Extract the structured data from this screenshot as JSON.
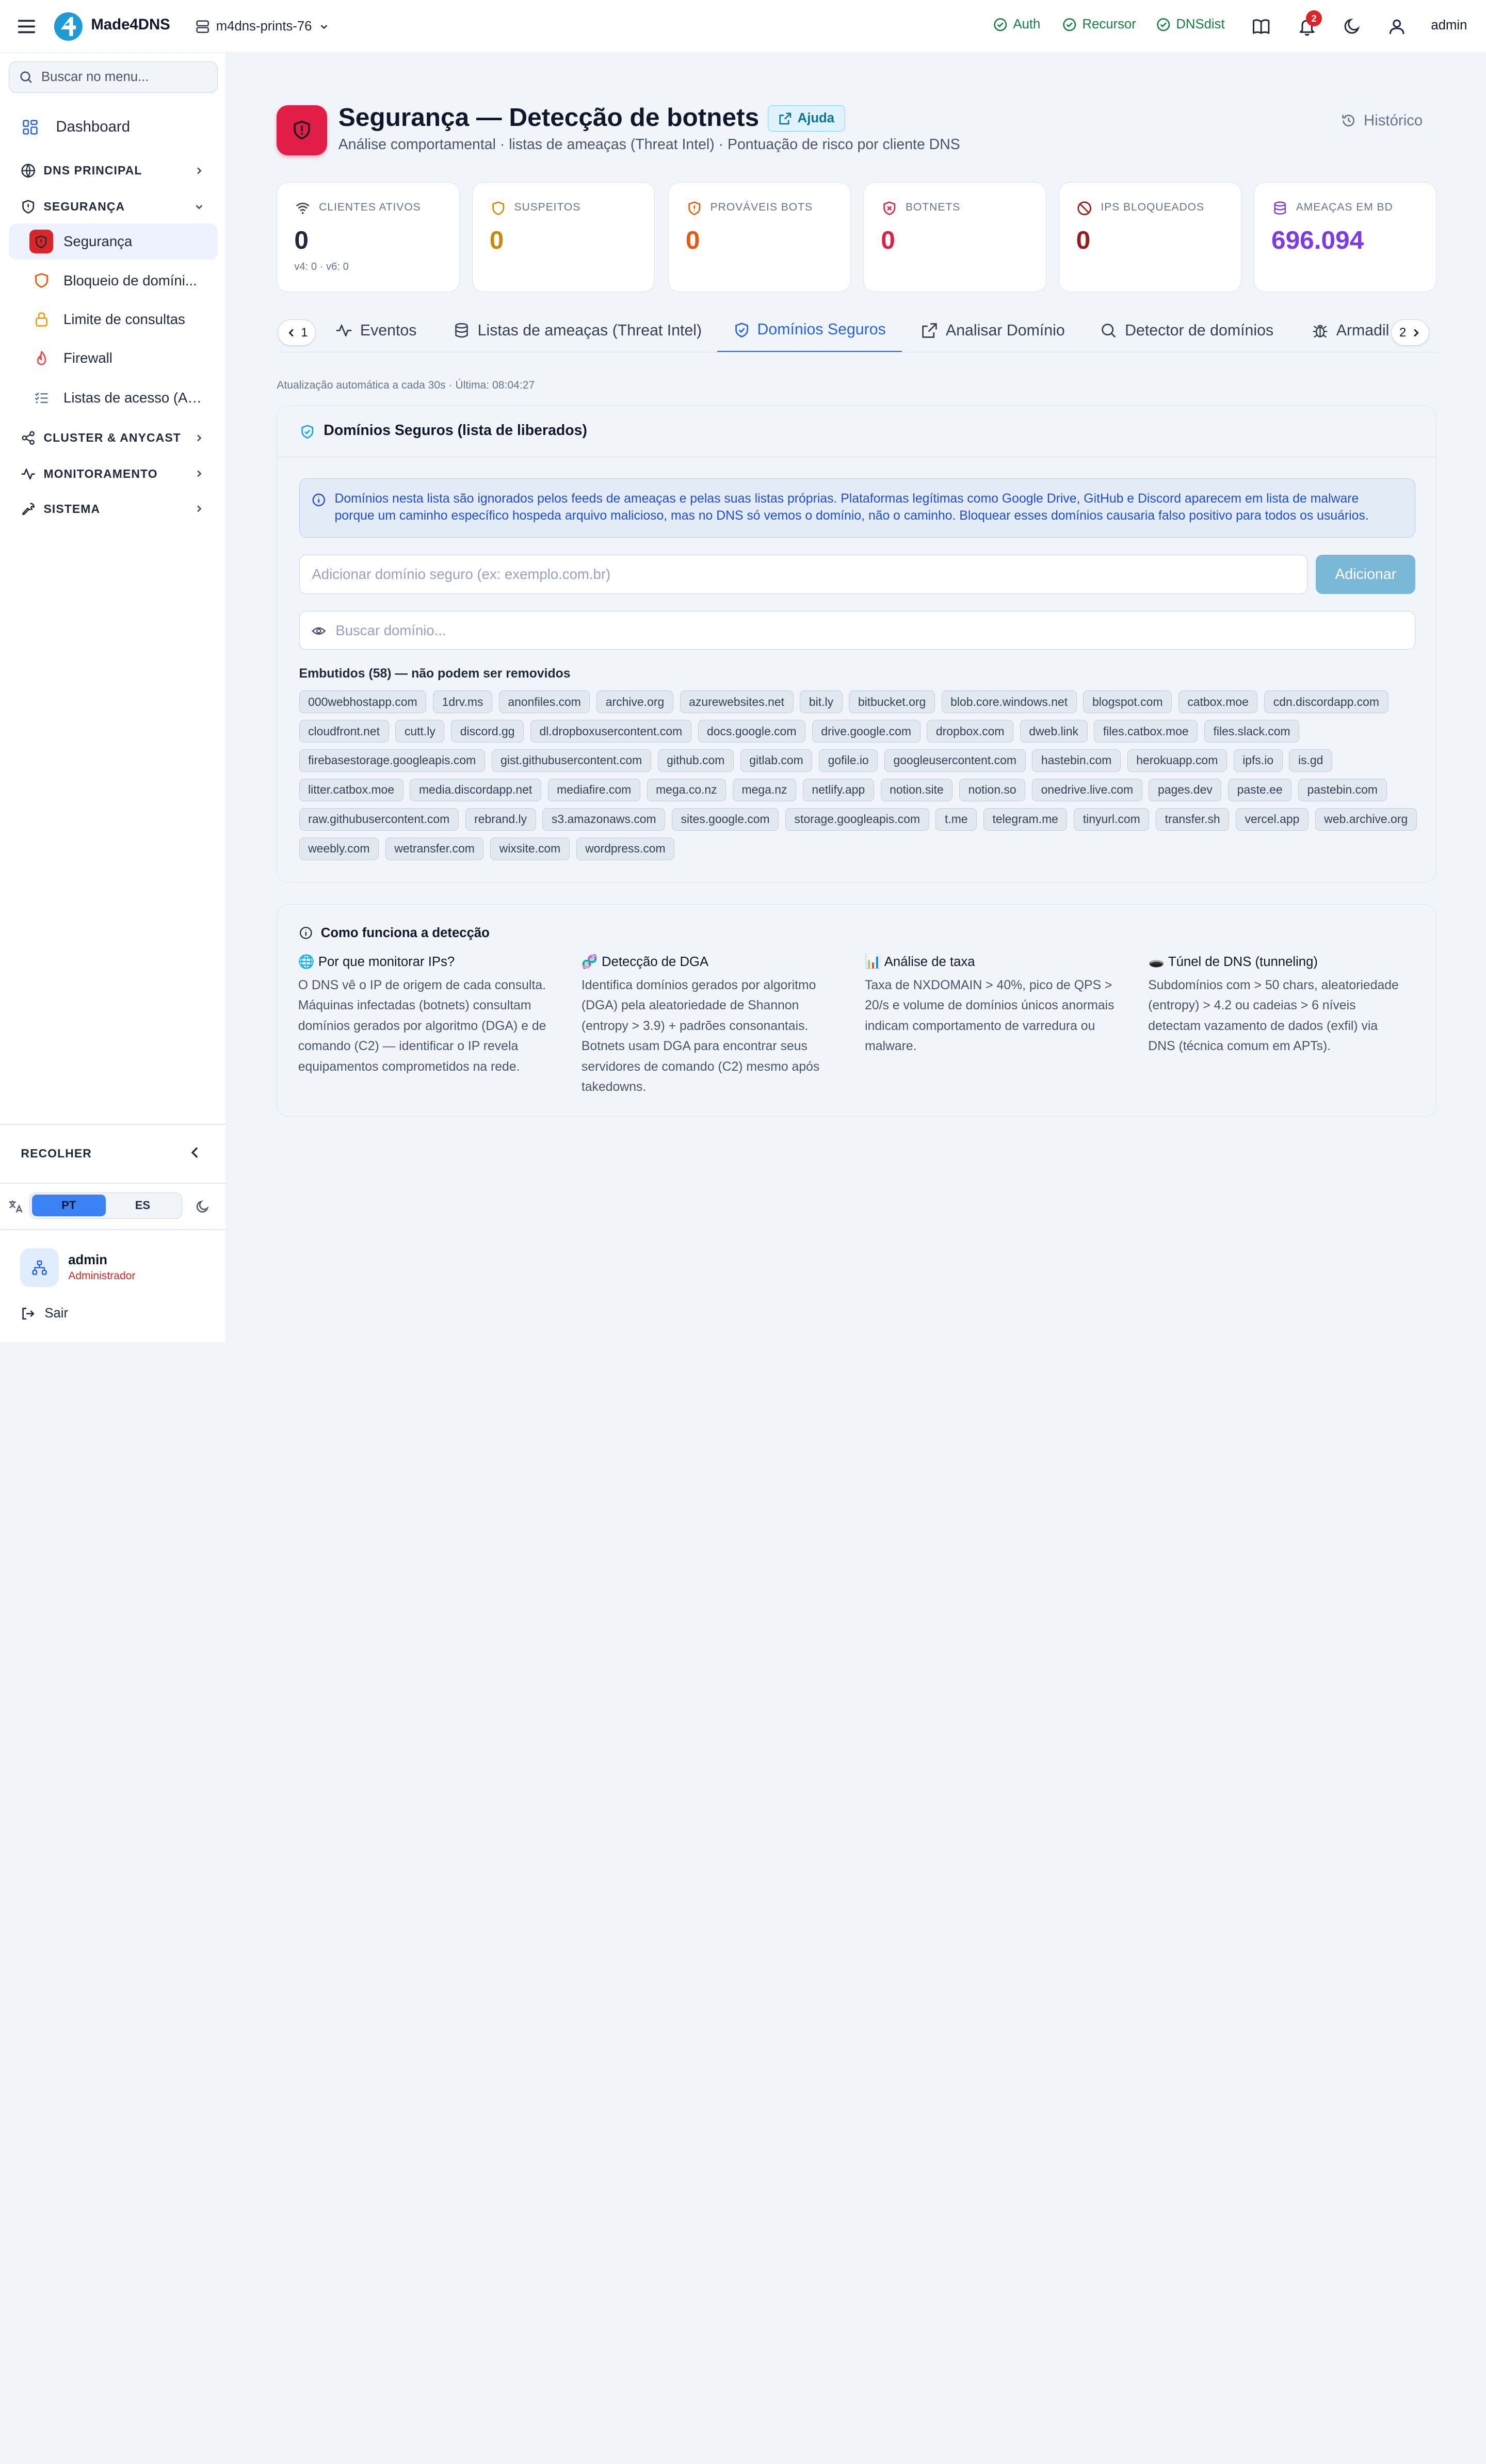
{
  "topbar": {
    "brand": "Made4DNS",
    "server": "m4dns-prints-76",
    "statuses": [
      "Auth",
      "Recursor",
      "DNSdist"
    ],
    "notifications_count": "2",
    "user": "admin",
    "accent": "#2563eb",
    "status_color": "#15803d"
  },
  "sidebar": {
    "search_placeholder": "Buscar no menu...",
    "dashboard": "Dashboard",
    "sections": {
      "dns": "DNS PRINCIPAL",
      "security": "SEGURANÇA",
      "cluster": "CLUSTER & ANYCAST",
      "monitoring": "MONITORAMENTO",
      "system": "SISTEMA"
    },
    "security_items": [
      "Segurança",
      "Bloqueio de domíni...",
      "Limite de consultas",
      "Firewall",
      "Listas de acesso (ACL)"
    ],
    "collapse": "RECOLHER",
    "lang": [
      "PT",
      "ES"
    ],
    "user_name": "admin",
    "user_role": "Administrador",
    "logout": "Sair"
  },
  "page": {
    "title": "Segurança — Detecção de botnets",
    "help": "Ajuda",
    "subtitle": "Análise comportamental · listas de ameaças (Threat Intel) · Pontuação de risco por cliente DNS",
    "history": "Histórico"
  },
  "stats": [
    {
      "label": "CLIENTES ATIVOS",
      "value": "0",
      "sub": "v4: 0 · v6: 0",
      "color": "#1e293b",
      "icon": "wifi-icon"
    },
    {
      "label": "SUSPEITOS",
      "value": "0",
      "color": "#ca8a04",
      "icon": "shield-outline-icon"
    },
    {
      "label": "PROVÁVEIS BOTS",
      "value": "0",
      "color": "#ea580c",
      "icon": "shield-alert-icon"
    },
    {
      "label": "BOTNETS",
      "value": "0",
      "color": "#e11d48",
      "icon": "shield-x-icon"
    },
    {
      "label": "IPS BLOQUEADOS",
      "value": "0",
      "color": "#991b1b",
      "icon": "ban-icon"
    },
    {
      "label": "AMEAÇAS EM BD",
      "value": "696.094",
      "color": "#7c3aed",
      "icon": "database-icon"
    }
  ],
  "tabs": {
    "prev_page": "1",
    "next_page": "2",
    "items": [
      "Eventos",
      "Listas de ameaças (Threat Intel)",
      "Domínios Seguros",
      "Analisar Domínio",
      "Detector de domínios",
      "Armadil"
    ],
    "active": "Domínios Seguros"
  },
  "auto_refresh": "Atualização automática a cada 30s · Última: 08:04:27",
  "safe_domains": {
    "title": "Domínios Seguros (lista de liberados)",
    "info": "Domínios nesta lista são ignorados pelos feeds de ameaças e pelas suas listas próprias. Plataformas legítimas como Google Drive, GitHub e Discord aparecem em lista de malware porque um caminho específico hospeda arquivo malicioso, mas no DNS só vemos o domínio, não o caminho. Bloquear esses domínios causaria falso positivo para todos os usuários.",
    "add_placeholder": "Adicionar domínio seguro (ex: exemplo.com.br)",
    "add_button": "Adicionar",
    "search_placeholder": "Buscar domínio...",
    "builtin_title": "Embutidos (58) — não podem ser removidos",
    "domains": [
      "000webhostapp.com",
      "1drv.ms",
      "anonfiles.com",
      "archive.org",
      "azurewebsites.net",
      "bit.ly",
      "bitbucket.org",
      "blob.core.windows.net",
      "blogspot.com",
      "catbox.moe",
      "cdn.discordapp.com",
      "cloudfront.net",
      "cutt.ly",
      "discord.gg",
      "dl.dropboxusercontent.com",
      "docs.google.com",
      "drive.google.com",
      "dropbox.com",
      "dweb.link",
      "files.catbox.moe",
      "files.slack.com",
      "firebasestorage.googleapis.com",
      "gist.githubusercontent.com",
      "github.com",
      "gitlab.com",
      "gofile.io",
      "googleusercontent.com",
      "hastebin.com",
      "herokuapp.com",
      "ipfs.io",
      "is.gd",
      "litter.catbox.moe",
      "media.discordapp.net",
      "mediafire.com",
      "mega.co.nz",
      "mega.nz",
      "netlify.app",
      "notion.site",
      "notion.so",
      "onedrive.live.com",
      "pages.dev",
      "paste.ee",
      "pastebin.com",
      "raw.githubusercontent.com",
      "rebrand.ly",
      "s3.amazonaws.com",
      "sites.google.com",
      "storage.googleapis.com",
      "t.me",
      "telegram.me",
      "tinyurl.com",
      "transfer.sh",
      "vercel.app",
      "web.archive.org",
      "weebly.com",
      "wetransfer.com",
      "wixsite.com",
      "wordpress.com"
    ]
  },
  "how": {
    "title": "Como funciona a detecção",
    "columns": [
      {
        "title": "🌐 Por que monitorar IPs?",
        "body": "O DNS vê o IP de origem de cada consulta. Máquinas infectadas (botnets) consultam domínios gerados por algoritmo (DGA) e de comando (C2) — identificar o IP revela equipamentos comprometidos na rede."
      },
      {
        "title": "🧬 Detecção de DGA",
        "body": "Identifica domínios gerados por algoritmo (DGA) pela aleatoriedade de Shannon (entropy > 3.9) + padrões consonantais. Botnets usam DGA para encontrar seus servidores de comando (C2) mesmo após takedowns."
      },
      {
        "title": "📊 Análise de taxa",
        "body": "Taxa de NXDOMAIN > 40%, pico de QPS > 20/s e volume de domínios únicos anormais indicam comportamento de varredura ou malware."
      },
      {
        "title": "🕳️ Túnel de DNS (tunneling)",
        "body": "Subdomínios com > 50 chars, aleatoriedade (entropy) > 4.2 ou cadeias > 6 níveis detectam vazamento de dados (exfil) via DNS (técnica comum em APTs)."
      }
    ]
  }
}
